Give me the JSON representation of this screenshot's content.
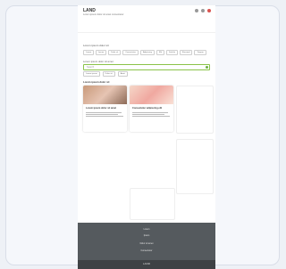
{
  "header": {
    "logo": "LAND",
    "tagline": "Lorem ipsum dolor sit amet consectetur"
  },
  "categories": {
    "title": "Lorem ipsum dolor sit",
    "items": [
      "Lorem",
      "Ipsum",
      "Dolor sit",
      "Consectetur",
      "Adipiscing",
      "Elit",
      "Sed do",
      "Eiusmod",
      "Tempor"
    ]
  },
  "search": {
    "label": "Lorem ipsum dolor sit amet",
    "placeholder": "Search"
  },
  "filters": [
    "Lorem ipsum",
    "Dolor sit",
    "Amet"
  ],
  "results": {
    "title": "Lorem ipsum dolor sit",
    "cards": [
      {
        "title": "Lorem ipsum dolor sit amet"
      },
      {
        "title": "Consectetur adipiscing elit"
      }
    ]
  },
  "footer": {
    "links": [
      "Lorem",
      "Ipsum",
      "Dolor sit amet",
      "Consectetur"
    ],
    "brand": "LAND"
  }
}
